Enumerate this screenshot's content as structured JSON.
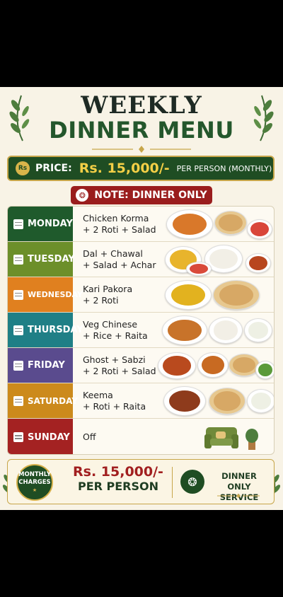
{
  "title": {
    "line1": "WEEKLY",
    "line2": "DINNER MENU"
  },
  "price_bar": {
    "label": "PRICE:",
    "value": "Rs. 15,000/-",
    "note": "PER PERSON (MONTHLY)",
    "tag_icon": "price-tag-icon",
    "tag_text": "Rs"
  },
  "note": {
    "text": "NOTE: DINNER ONLY",
    "icon": "fork-knife-icon",
    "icon_glyph": "❂"
  },
  "days": [
    {
      "day": "MONDAY",
      "line1": "Chicken Korma",
      "line2": "+ 2 Roti + Salad",
      "color": "#1f5a2c"
    },
    {
      "day": "TUESDAY",
      "line1": "Dal + Chawal",
      "line2": "+ Salad + Achar",
      "color": "#6c8f2a"
    },
    {
      "day": "WEDNESDAY",
      "line1": "Kari Pakora",
      "line2": "+ 2 Roti",
      "color": "#e0801f"
    },
    {
      "day": "THURSDAY",
      "line1": "Veg Chinese",
      "line2": "+ Rice + Raita",
      "color": "#1f7f86"
    },
    {
      "day": "FRIDAY",
      "line1": "Ghost + Sabzi",
      "line2": "+ 2 Roti + Salad",
      "color": "#5a4b8e"
    },
    {
      "day": "SATURDAY",
      "line1": "Keema",
      "line2": "+ Roti + Raita",
      "color": "#cc8a1c"
    },
    {
      "day": "SUNDAY",
      "line1": "Off",
      "line2": "",
      "color": "#a42222"
    }
  ],
  "bottom": {
    "badge_line1": "MONTHLY",
    "badge_line2": "CHARGES",
    "badge_star": "★",
    "amount": "Rs. 15,000/-",
    "per": "PER PERSON",
    "service_line1": "DINNER ONLY",
    "service_line2": "SERVICE",
    "service_icon": "fork-knife-icon",
    "service_glyph": "❂"
  },
  "colors": {
    "background": "#f8f3e6",
    "green": "#1f4d23",
    "gold": "#c7a64a",
    "red": "#9a1d1d"
  }
}
